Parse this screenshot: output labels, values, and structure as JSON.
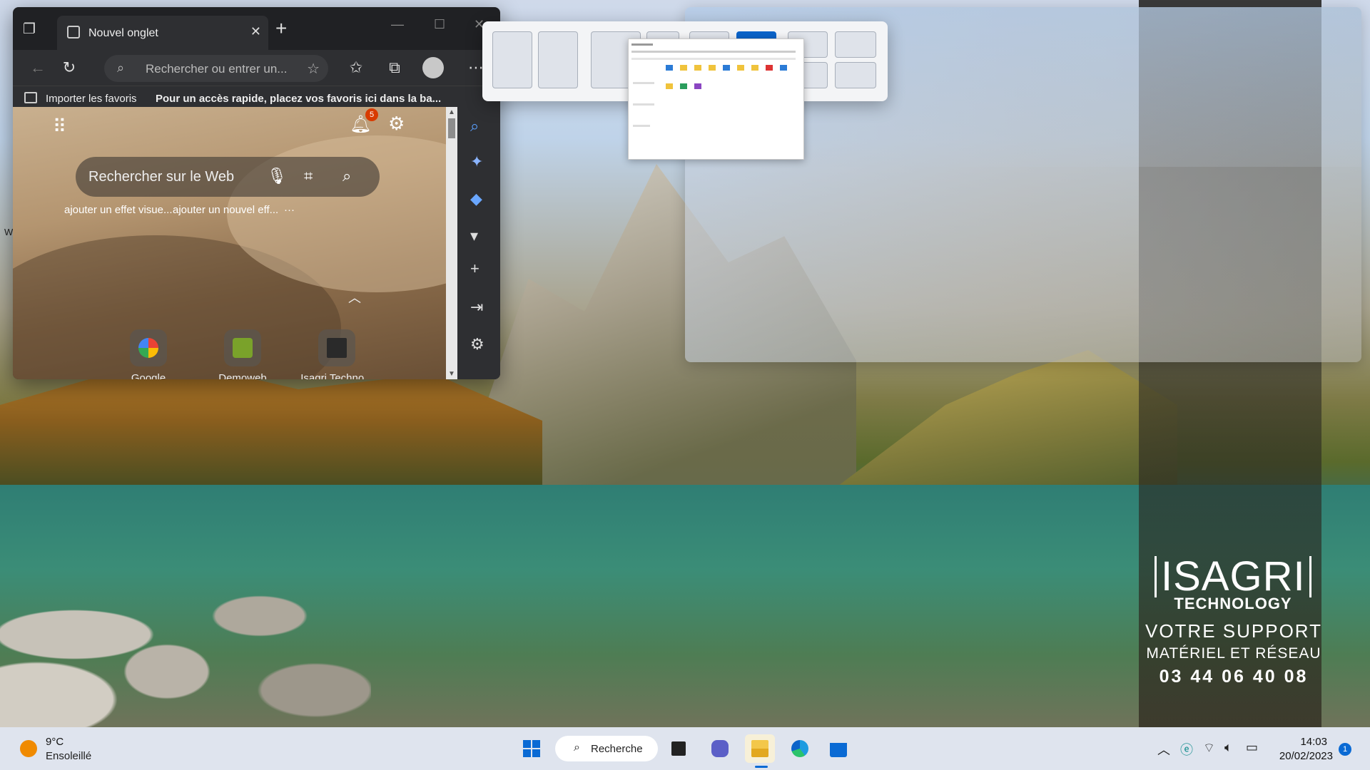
{
  "browser": {
    "tab_title": "Nouvel onglet",
    "address_placeholder": "Rechercher ou entrer un...",
    "favbar_import": "Importer les favoris",
    "favbar_hint": "Pour un accès rapide, placez vos favoris ici dans la ba...",
    "notification_count": "5",
    "web_search_placeholder": "Rechercher sur le Web",
    "suggestions": [
      "ajouter un effet visue...",
      "ajouter un nouvel eff...",
      "···"
    ],
    "quick_links": [
      {
        "label": "Google"
      },
      {
        "label": "Demoweb"
      },
      {
        "label": "Isagri Techno..."
      }
    ]
  },
  "desktop": {
    "partial_text": "W",
    "isagri": {
      "logo_main": "ISAGRI",
      "logo_sub": "TECHNOLOGY",
      "slogan1": "VOTRE SUPPORT",
      "slogan2": "MATÉRIEL ET RÉSEAU",
      "phone": "03 44 06 40 08"
    }
  },
  "taskbar": {
    "weather_temp": "9°C",
    "weather_condition": "Ensoleillé",
    "search_label": "Recherche",
    "time": "14:03",
    "date": "20/02/2023",
    "notification_count": "1"
  },
  "colors": {
    "accent": "#0b63c9",
    "badge": "#d83b01"
  }
}
